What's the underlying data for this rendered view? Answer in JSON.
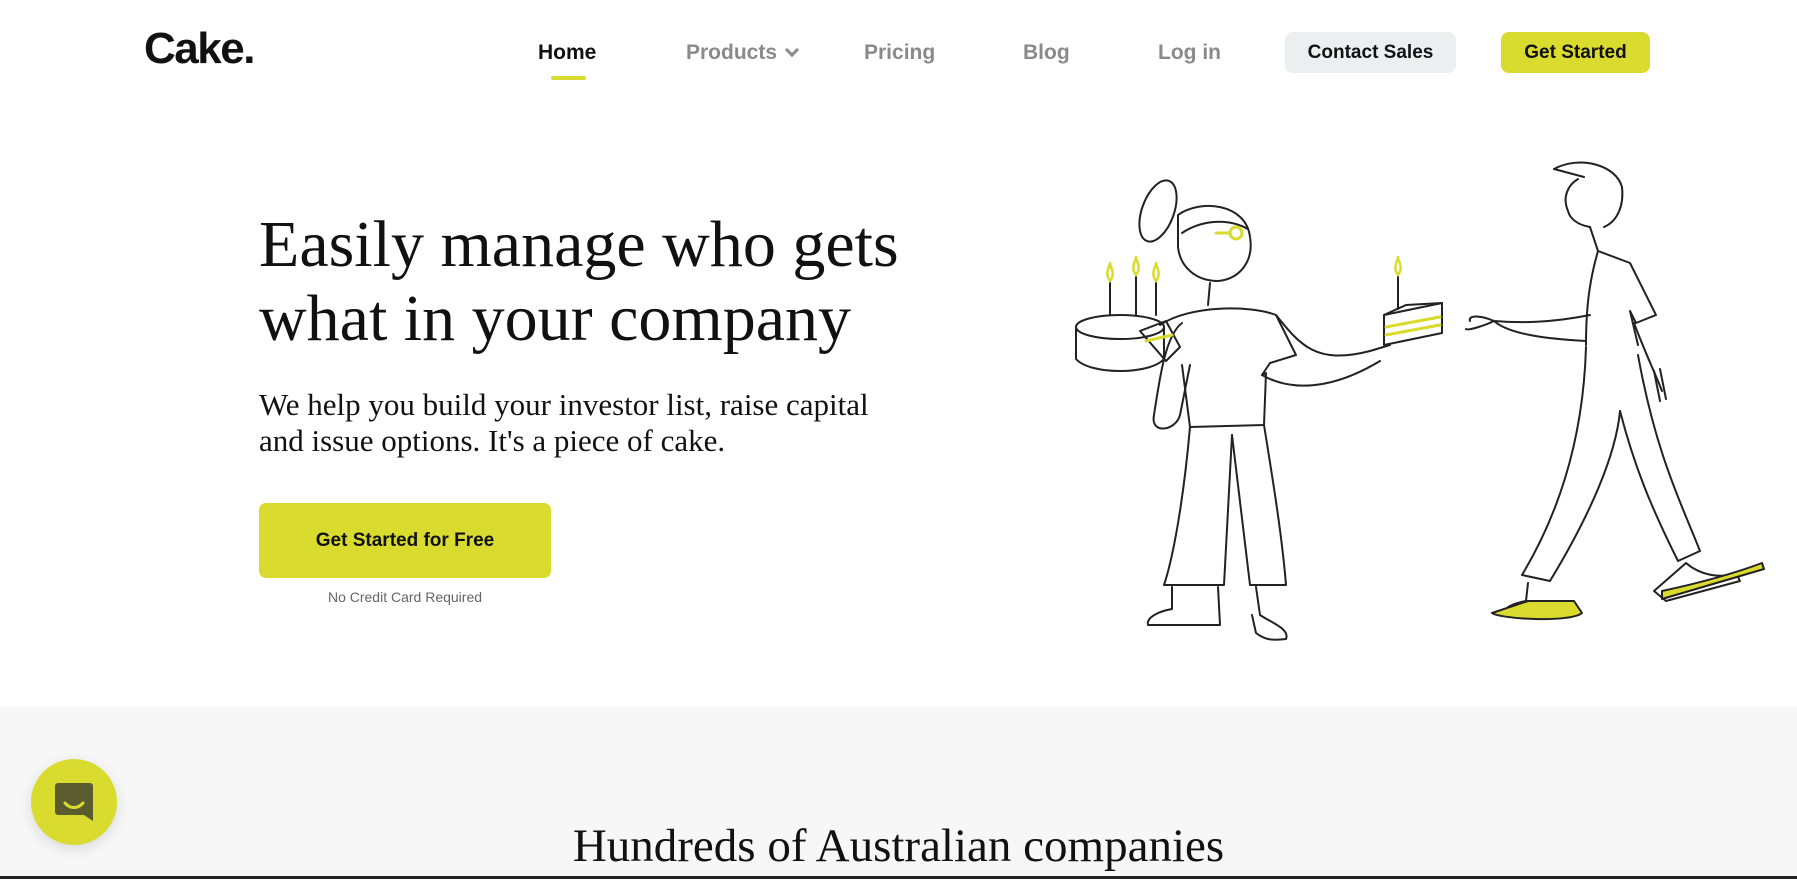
{
  "header": {
    "logo": "Cake.",
    "nav": {
      "home": "Home",
      "products": "Products",
      "pricing": "Pricing",
      "blog": "Blog",
      "login": "Log in"
    },
    "contact_sales": "Contact Sales",
    "get_started": "Get Started"
  },
  "hero": {
    "title_line1": "Easily manage who gets",
    "title_line2": "what in your company",
    "subtitle_line1": "We help you build your investor list, raise capital",
    "subtitle_line2": "and issue options. It's a piece of cake.",
    "cta": "Get Started for Free",
    "cta_note": "No Credit Card Required"
  },
  "social_proof": {
    "title": "Hundreds of Australian companies"
  },
  "colors": {
    "accent": "#d9db2e",
    "text": "#111111",
    "muted": "#8a8a8a",
    "band_bg": "#f7f7f7",
    "contact_bg": "#ebeff0"
  },
  "icons": {
    "chat": "chat-bubble-icon",
    "products_dropdown": "chevron-down-icon"
  }
}
